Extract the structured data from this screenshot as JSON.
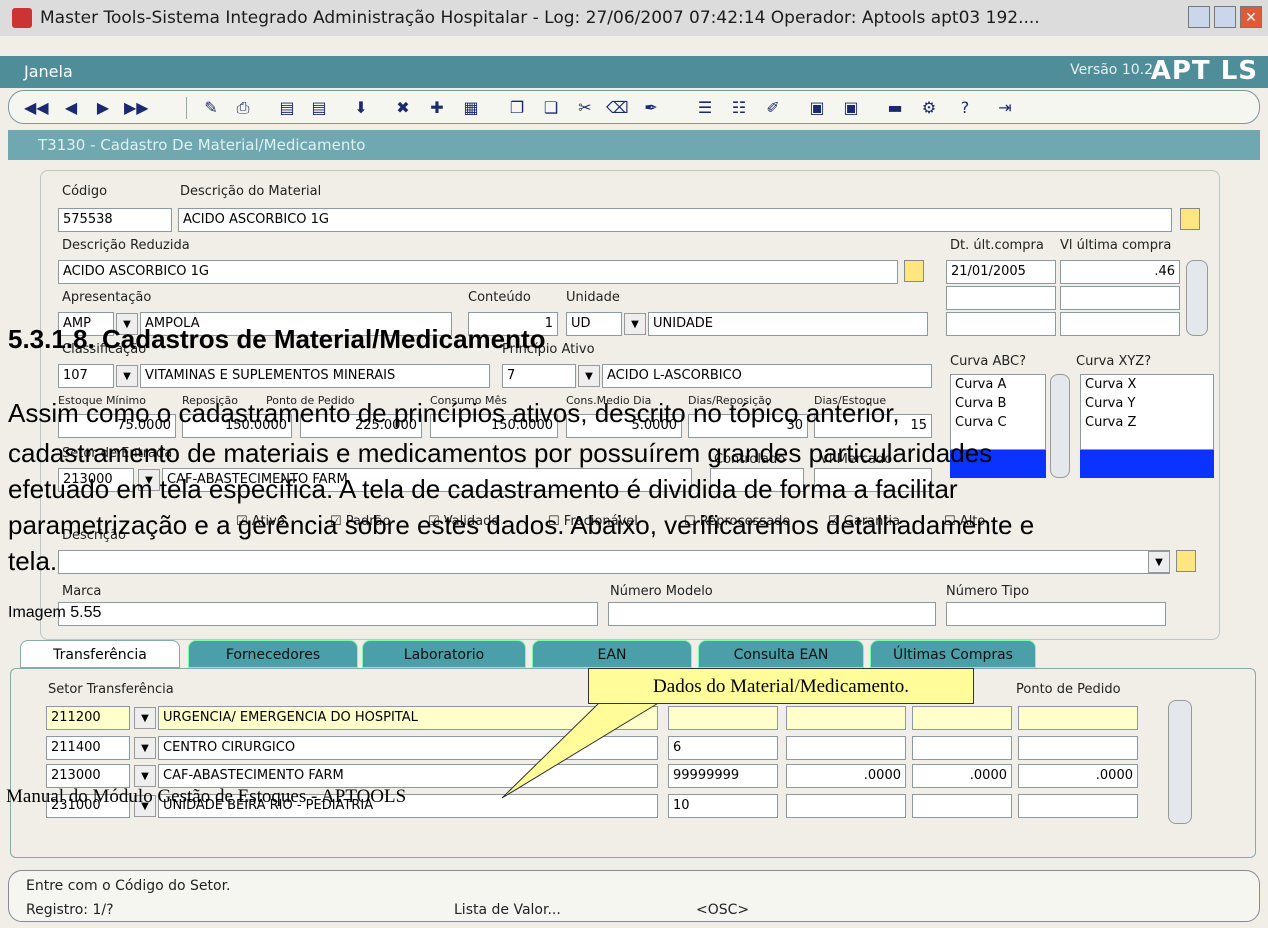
{
  "window": {
    "title": "Master Tools-Sistema Integrado Administração Hospitalar - Log: 27/06/2007 07:42:14 Operador: Aptools apt03 192....",
    "menu": "Janela",
    "version": "Versão 10.2",
    "logo": "APT LS"
  },
  "form": {
    "title": "T3130 - Cadastro De Material/Medicamento",
    "labels": {
      "codigo": "Código",
      "descricao": "Descrição do Material",
      "reduzida": "Descrição Reduzida",
      "dt_ult": "Dt. últ.compra",
      "vl_ult": "Vl última compra",
      "apresentacao": "Apresentação",
      "conteudo": "Conteúdo",
      "unidade": "Unidade",
      "classificacao": "Classificação",
      "principio": "Princípio Ativo",
      "curva_abc": "Curva ABC?",
      "curva_xyz": "Curva XYZ?",
      "est_min": "Estoque Mínimo",
      "reposicao": "Reposição",
      "ponto_pedido": "Ponto de Pedido",
      "consumo": "Consumo Mês",
      "cons_medio": "Cons.Medio Dia",
      "dias_rep": "Dias/Reposição",
      "dias_est": "Dias/Estoque",
      "setor_entrada": "Setor de Entrada",
      "controlado": "Controlado",
      "mercado": "Vl Mercado",
      "descricao2": "Descrição",
      "marca": "Marca",
      "numero_modelo": "Número Modelo",
      "numero_tipo": "Número Tipo"
    },
    "values": {
      "codigo": "575538",
      "descricao": "ACIDO ASCORBICO 1G",
      "reduzida": "ACIDO ASCORBICO 1G",
      "dt_ult": "21/01/2005",
      "vl_ult": ".46",
      "apres_code": "AMP",
      "apres_desc": "AMPOLA",
      "conteudo": "1",
      "unidade_code": "UD",
      "unidade_desc": "UNIDADE",
      "classif_code": "107",
      "classif_desc": "VITAMINAS E SUPLEMENTOS MINERAIS",
      "princ_code": "7",
      "princ_desc": "ACIDO L-ASCORBICO",
      "est_min": "75.0000",
      "reposicao": "150.0000",
      "ponto_pedido": "225.0000",
      "consumo": "150.0000",
      "cons_medio": "5.0000",
      "dias_rep": "30",
      "dias_est": "15",
      "setor_code": "213000",
      "setor_desc": "CAF-ABASTECIMENTO FARM"
    },
    "curva_abc": [
      "Curva A",
      "Curva B",
      "Curva C"
    ],
    "curva_xyz": [
      "Curva X",
      "Curva Y",
      "Curva Z"
    ],
    "checkboxes": [
      "Ativo",
      "Padrão",
      "Validade",
      "Fracionável",
      "Reprocessado",
      "Garantia",
      "Alto"
    ]
  },
  "tabs": [
    "Transferência",
    "Fornecedores",
    "Laboratorio",
    "EAN",
    "Consulta EAN",
    "Últimas Compras"
  ],
  "grid": {
    "col_setor": "Setor Transferência",
    "col_ponto": "Ponto de Pedido",
    "rows": [
      {
        "code": "211200",
        "name": "URGENCIA/ EMERGENCIA DO HOSPITAL",
        "v1": "",
        "v2": "",
        "v3": "",
        "v4": ""
      },
      {
        "code": "211400",
        "name": "CENTRO CIRURGICO",
        "v1": "6",
        "v2": "",
        "v3": "",
        "v4": ""
      },
      {
        "code": "213000",
        "name": "CAF-ABASTECIMENTO FARM",
        "v1": "99999999",
        "v2": ".0000",
        "v3": ".0000",
        "v4": ".0000"
      },
      {
        "code": "231000",
        "name": "UNIDADE BEIRA RIO - PEDIATRIA",
        "v1": "10",
        "v2": "",
        "v3": "",
        "v4": ""
      }
    ]
  },
  "callout": "Dados do Material/Medicamento.",
  "status": {
    "message": "Entre com o Código do Setor.",
    "registro": "Registro: 1/?",
    "lista": "Lista de Valor...",
    "osc": "<OSC>"
  },
  "doc": {
    "heading": "5.3.1.8. Cadastros de Material/Medicamento",
    "line1": "Assim como o cadastramento de princípios ativos, descrito no tópico anterior,",
    "line2": "cadastramento de materiais e medicamentos por possuírem grandes particularidades",
    "line3": "efetuado em tela específica. A tela de cadastramento é dividida de forma a facilitar",
    "line4": "parametrização e a gerência sobre estes dados. Abaixo, verificaremos detalhadamente e",
    "line5": "tela.",
    "caption": "Imagem 5.55",
    "footer": "Manual do Módulo Gestão de Estoques - APTOOLS"
  }
}
